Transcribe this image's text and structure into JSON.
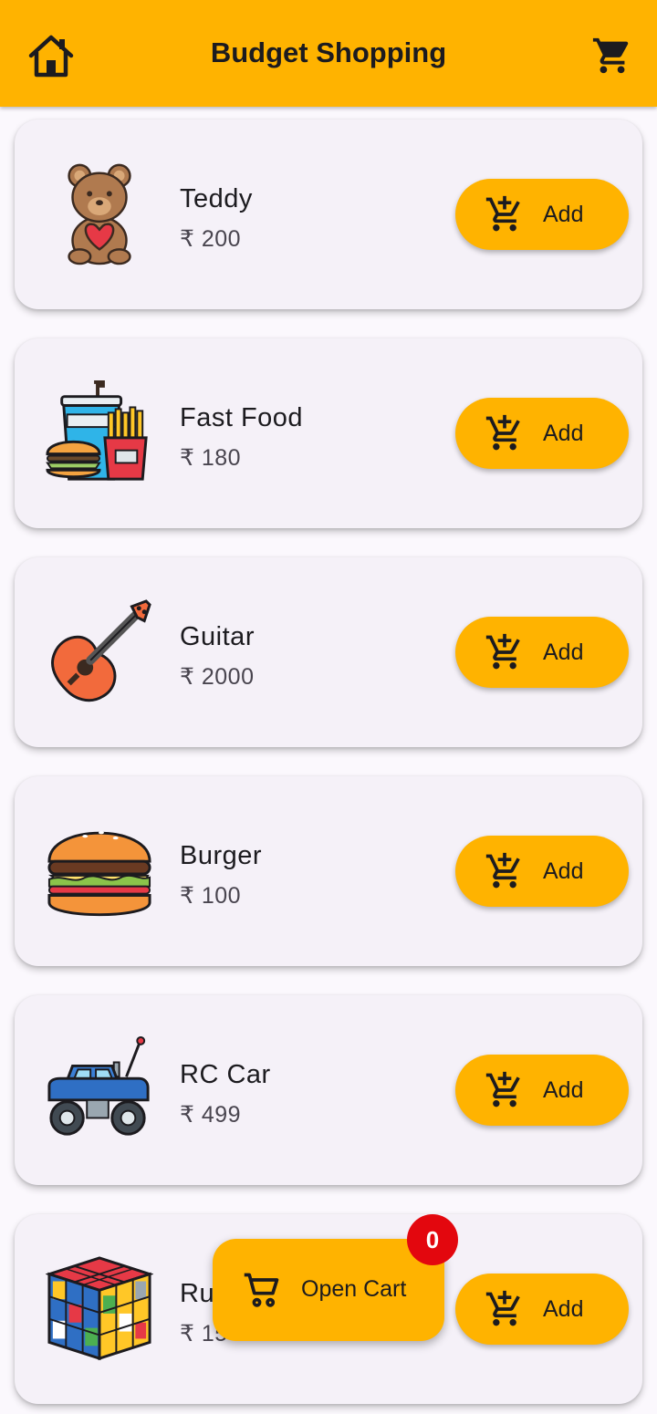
{
  "app_bar": {
    "title": "Budget Shopping",
    "home_icon": "home-icon",
    "cart_icon": "shopping-cart-icon",
    "color": "#ffb300"
  },
  "products": [
    {
      "name": "Teddy",
      "price": "₹ 200",
      "image": "teddy-bear-image",
      "add_label": "Add"
    },
    {
      "name": "Fast Food",
      "price": "₹ 180",
      "image": "fast-food-image",
      "add_label": "Add"
    },
    {
      "name": "Guitar",
      "price": "₹ 2000",
      "image": "guitar-image",
      "add_label": "Add"
    },
    {
      "name": "Burger",
      "price": "₹ 100",
      "image": "burger-image",
      "add_label": "Add"
    },
    {
      "name": "RC Car",
      "price": "₹ 499",
      "image": "rc-car-image",
      "add_label": "Add"
    },
    {
      "name": "Ru",
      "price": "₹ 15",
      "image": "rubiks-cube-image",
      "add_label": "Add"
    }
  ],
  "open_cart": {
    "label": "Open Cart",
    "badge_count": "0",
    "icon": "shopping-cart-icon",
    "badge_color": "#e3070e"
  }
}
